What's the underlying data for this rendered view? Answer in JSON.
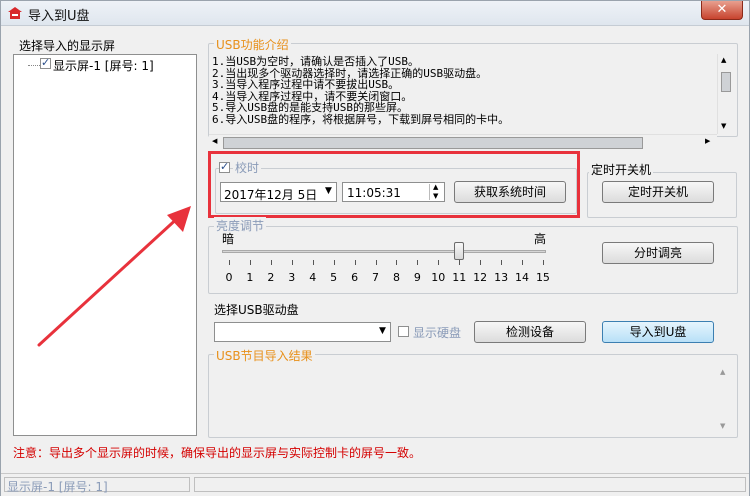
{
  "window": {
    "title": "导入到U盘",
    "close": "✕"
  },
  "screen_panel": {
    "label": "选择导入的显示屏",
    "items": [
      {
        "label": "显示屏-1 [屏号: 1]",
        "checked": true
      }
    ]
  },
  "usb_intro": {
    "label": "USB功能介绍",
    "lines": [
      "1.当USB为空时，请确认是否插入了USB。",
      "2.当出现多个驱动器选择时，请选择正确的USB驱动盘。",
      "3.当导入程序过程中请不要拔出USB。",
      "4.当导入程序过程中，请不要关闭窗口。",
      "5.导入USB盘的是能支持USB的那些屏。",
      "6.导入USB盘的程序，将根据屏号，下载到屏号相同的卡中。"
    ]
  },
  "time_group": {
    "label": "校时",
    "date": "2017年12月 5日",
    "time": "11:05:31",
    "get_time_button": "获取系统时间"
  },
  "power_group": {
    "label": "定时开关机",
    "button": "定时开关机"
  },
  "brightness": {
    "label": "亮度调节",
    "low": "暗",
    "high": "高",
    "value": 11,
    "ticks": [
      "0",
      "1",
      "2",
      "3",
      "4",
      "5",
      "6",
      "7",
      "8",
      "9",
      "10",
      "11",
      "12",
      "13",
      "14",
      "15"
    ],
    "button": "分时调亮"
  },
  "usb_drive": {
    "label": "选择USB驱动盘",
    "selected": "",
    "show_disk_label": "显示硬盘",
    "detect_button": "检测设备",
    "import_button": "导入到U盘"
  },
  "result": {
    "label": "USB节目导入结果"
  },
  "note": "注意：导出多个显示屏的时候，确保导出的显示屏与实际控制卡的屏号一致。",
  "statusbar": {
    "text": "显示屏-1 [屏号: 1]"
  },
  "icons": {
    "arrow": "annotation-arrow-icon",
    "highlight": "highlight-box"
  },
  "colors": {
    "accent_orange": "#e8901a",
    "annotation_red": "#e8323c",
    "note_red": "#d40000"
  }
}
